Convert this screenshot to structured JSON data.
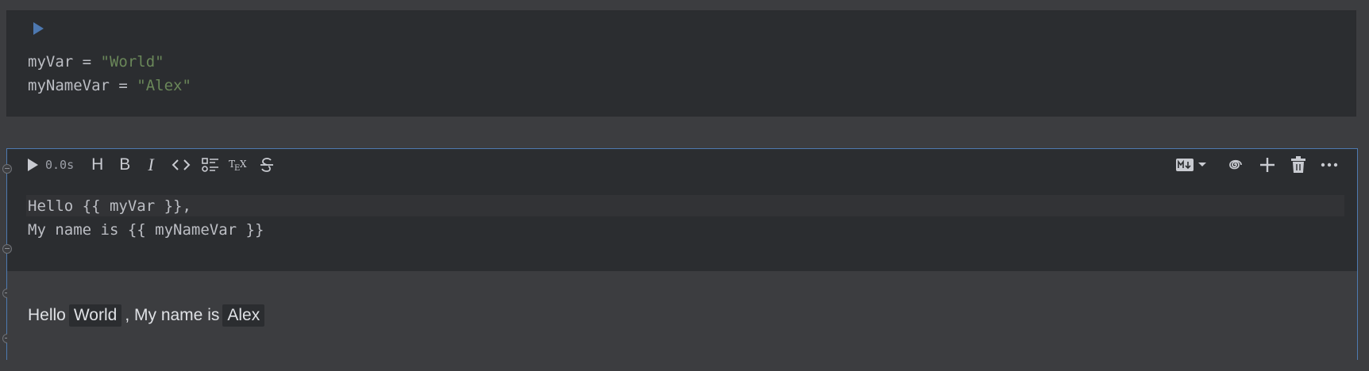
{
  "code_cell": {
    "lines": [
      {
        "var": "myVar",
        "op": " = ",
        "value": "\"World\""
      },
      {
        "var": "myNameVar",
        "op": " = ",
        "value": "\"Alex\""
      }
    ]
  },
  "md_cell": {
    "exec_time": "0.0s",
    "toolbar": {
      "heading_label": "H",
      "bold_label": "B",
      "italic_label": "I"
    },
    "source_lines": [
      "Hello {{ myVar }},",
      "My name is {{ myNameVar }}"
    ],
    "rendered": {
      "prefix": "Hello",
      "var1": "World",
      "middle": ", My name is",
      "var2": "Alex"
    }
  },
  "colors": {
    "accent": "#4e7ab0",
    "run_icon": "#4d78b0",
    "string": "#6a8759"
  },
  "icons": [
    "run-icon",
    "heading-icon",
    "bold-icon",
    "italic-icon",
    "code-icon",
    "list-icon",
    "tex-icon",
    "strikethrough-icon",
    "markdown-mode-icon",
    "chevron-down-icon",
    "spiral-icon",
    "add-icon",
    "delete-icon",
    "more-icon"
  ]
}
